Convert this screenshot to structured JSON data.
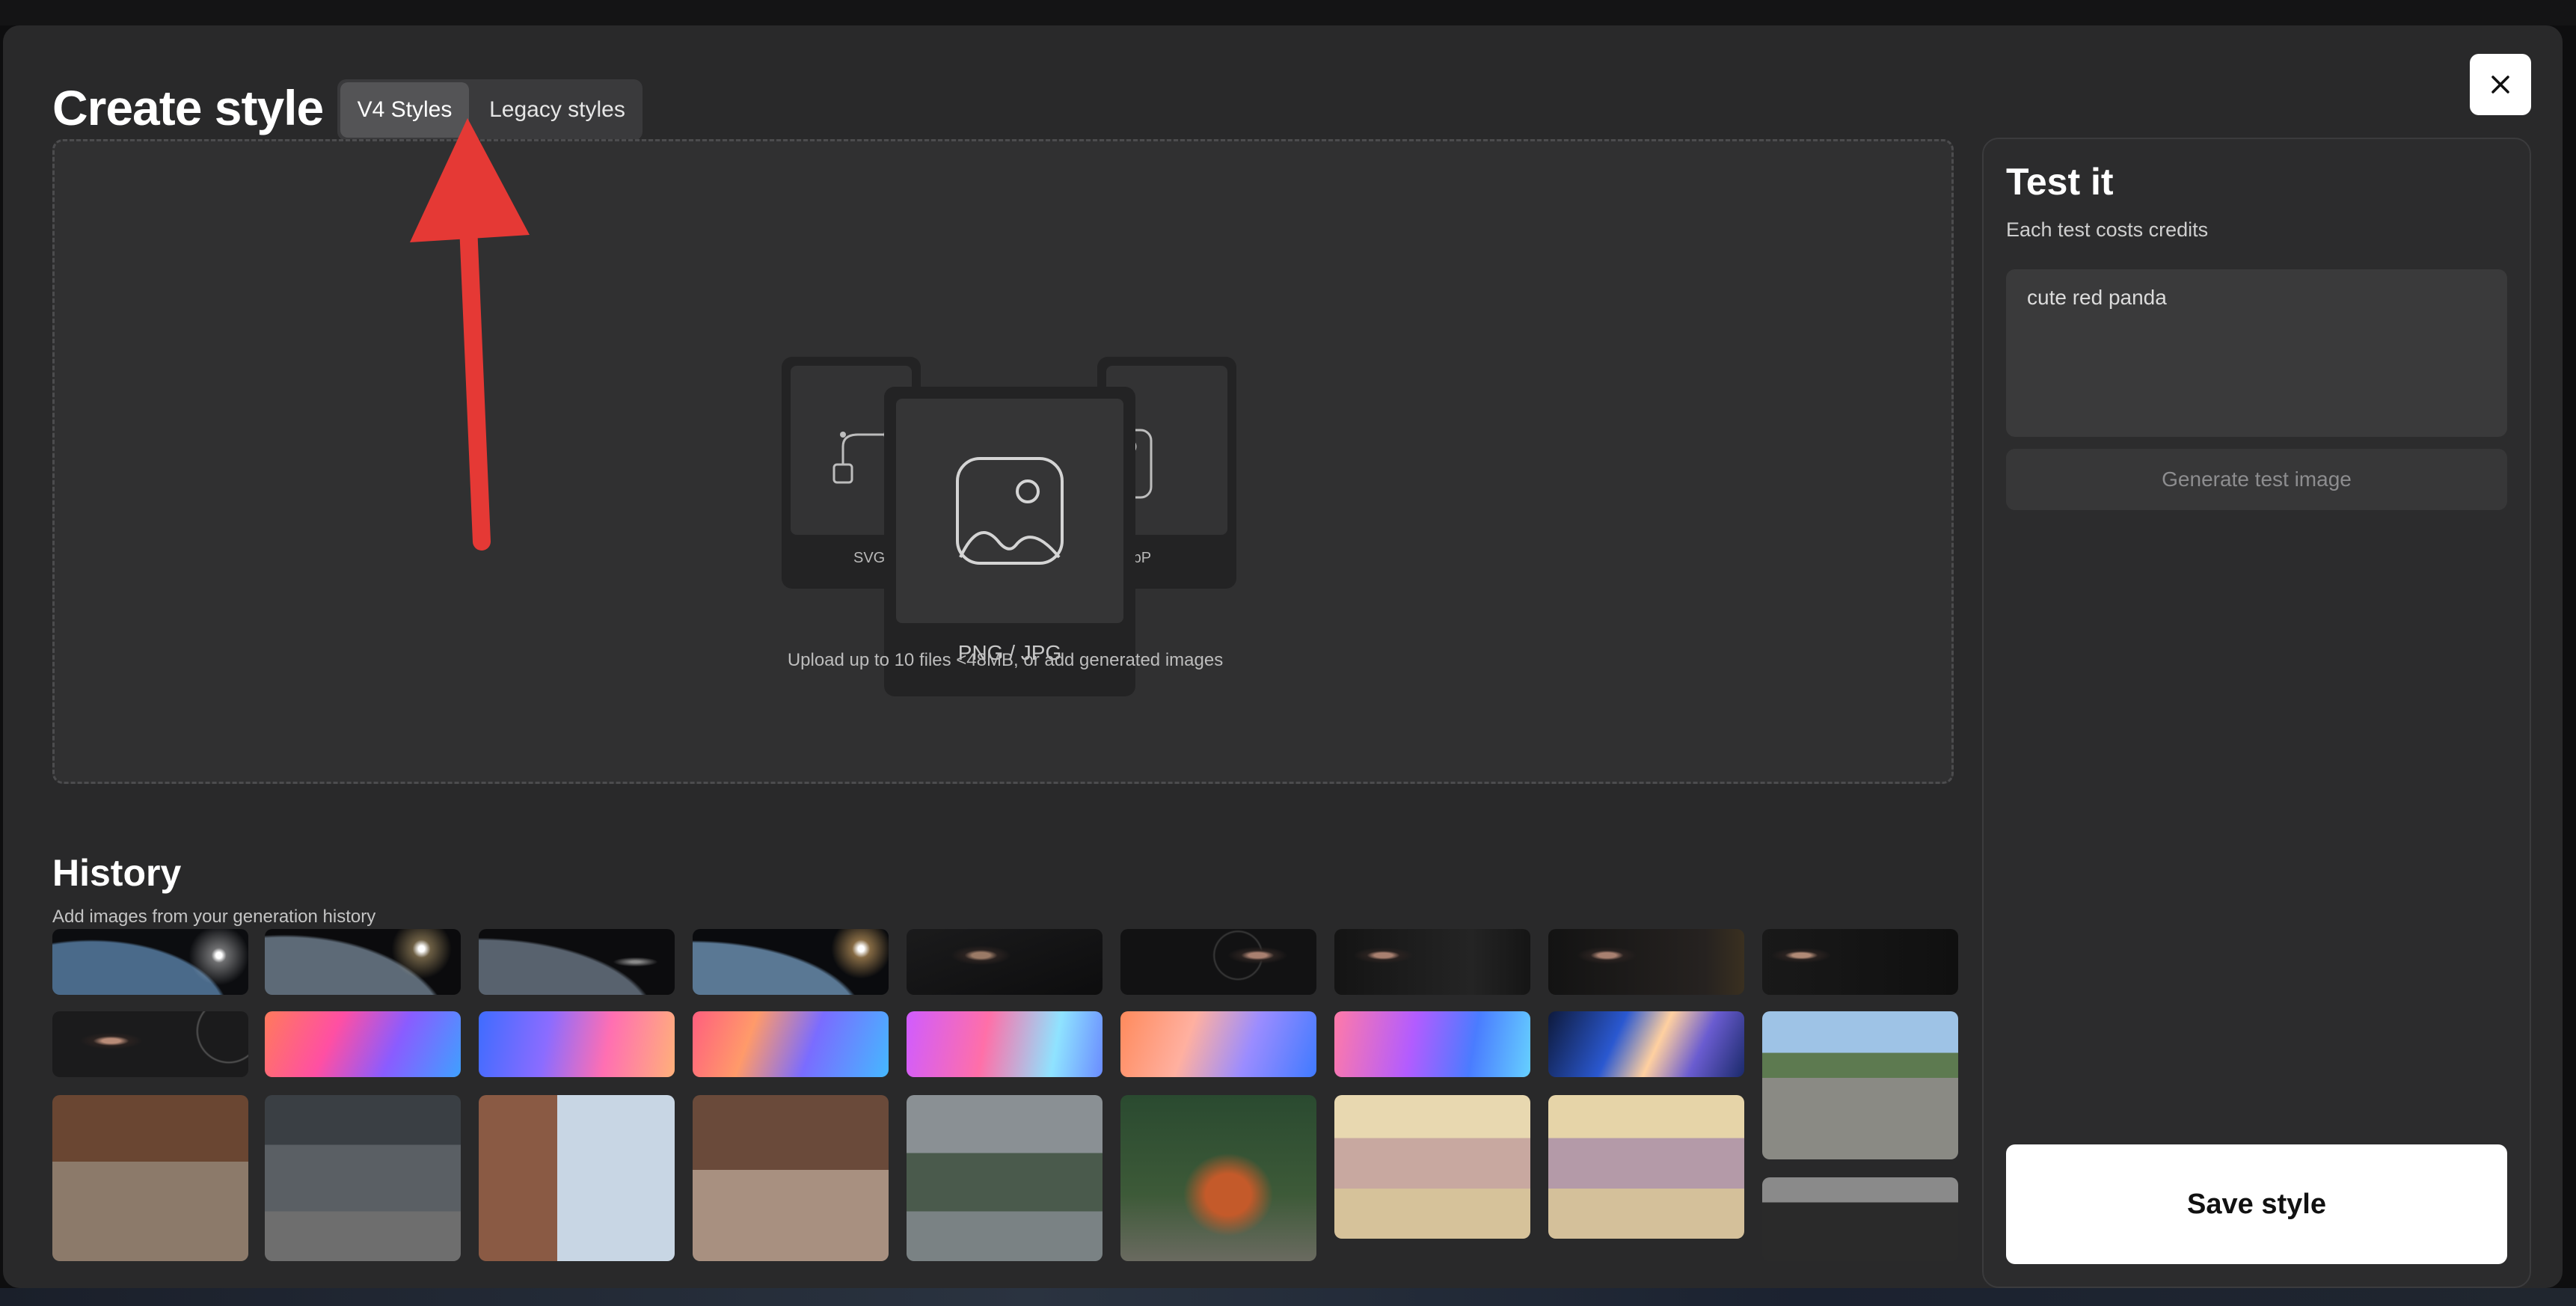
{
  "header": {
    "title": "Create style",
    "tabs": [
      {
        "label": "V4 Styles",
        "active": true
      },
      {
        "label": "Legacy styles",
        "active": false
      }
    ],
    "close_icon": "close-icon"
  },
  "upload": {
    "cards": {
      "left_label": "SVG",
      "center_label": "PNG / JPG",
      "right_label": "WebP"
    },
    "hint": "Upload up to 10 files <48MB, or add generated images"
  },
  "history": {
    "title": "History",
    "subtitle": "Add images from your generation history"
  },
  "test_panel": {
    "title": "Test it",
    "subtitle": "Each test costs credits",
    "prompt_value": "cute red panda",
    "generate_label": "Generate test image",
    "save_label": "Save style"
  },
  "colors": {
    "modal_bg": "#29292a",
    "accent_arrow": "#e53935",
    "primary_button": "#ffffff"
  }
}
